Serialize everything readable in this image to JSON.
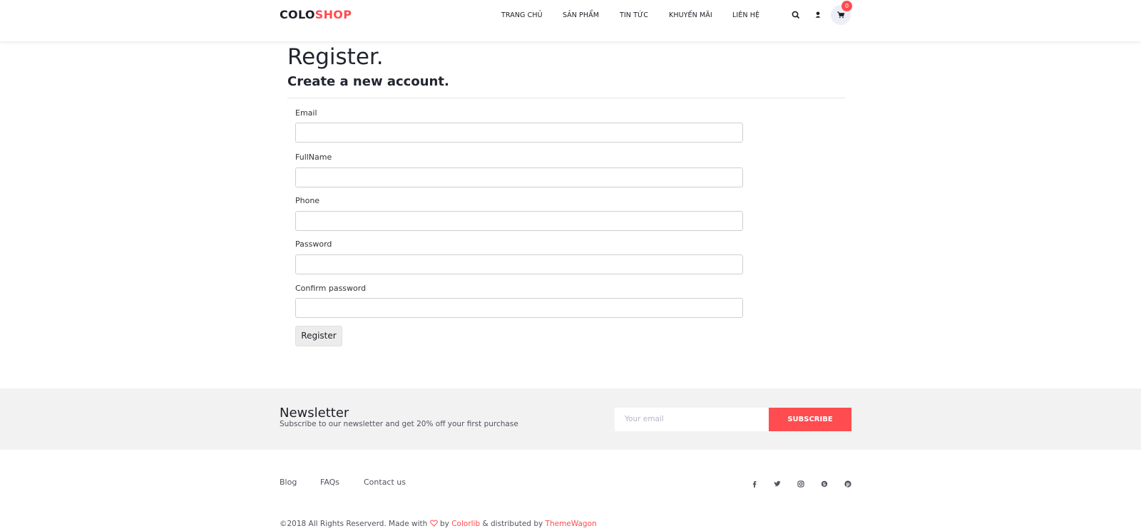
{
  "header": {
    "logo_part1": "COLO",
    "logo_part2": "SHOP",
    "nav": [
      "TRANG CHỦ",
      "SẢN PHẨM",
      "TIN TỨC",
      "KHUYẾN MÃI",
      "LIÊN HỆ"
    ],
    "icons": [
      "search-icon",
      "user-icon",
      "cart-icon"
    ],
    "cart_count": "0"
  },
  "main": {
    "title": "Register.",
    "subtitle": "Create a new account.",
    "fields": [
      {
        "label": "Email",
        "value": ""
      },
      {
        "label": "FullName",
        "value": ""
      },
      {
        "label": "Phone",
        "value": ""
      },
      {
        "label": "Password",
        "value": ""
      },
      {
        "label": "Confirm password",
        "value": ""
      }
    ],
    "submit_label": "Register"
  },
  "newsletter": {
    "title": "Newsletter",
    "subtitle": "Subscribe to our newsletter and get 20% off your first purchase",
    "email_placeholder": "Your email",
    "button_label": "SUBSCRIBE"
  },
  "footer": {
    "links": [
      "Blog",
      "FAQs",
      "Contact us"
    ],
    "social_icons": [
      "facebook-icon",
      "twitter-icon",
      "instagram-icon",
      "skype-icon",
      "pinterest-icon"
    ],
    "copyright_prefix": "©2018 All Rights Reserverd. Made with",
    "copyright_by": "by",
    "colorlib": "Colorlib",
    "distributed": "& distributed by",
    "themewagon": "ThemeWagon"
  },
  "colors": {
    "accent": "#fe4c50",
    "text": "#1e1e27",
    "newsletter_bg": "#f2f2f2"
  }
}
